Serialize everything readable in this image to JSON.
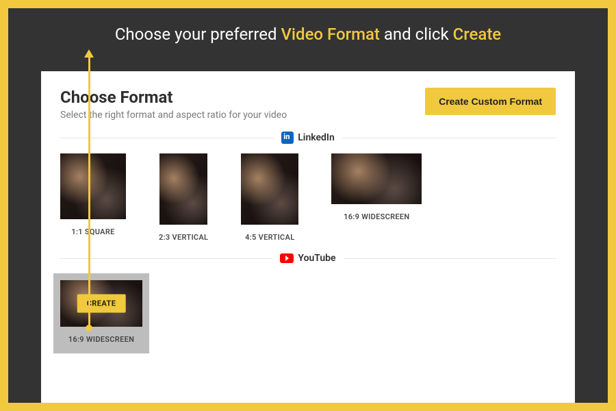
{
  "instruction": {
    "pre": "Choose  your preferred  ",
    "h1": "Video Format",
    "mid": " and click ",
    "h2": "Create"
  },
  "panel": {
    "title": "Choose Format",
    "subtitle": "Select the right format and aspect ratio for your video",
    "custom_button": "Create Custom Format"
  },
  "sections": {
    "linkedin": {
      "label": "LinkedIn",
      "formats": [
        {
          "label": "1:1 SQUARE"
        },
        {
          "label": "2:3 VERTICAL"
        },
        {
          "label": "4:5 VERTICAL"
        },
        {
          "label": "16:9 WIDESCREEN"
        }
      ]
    },
    "youtube": {
      "label": "YouTube",
      "formats": [
        {
          "label": "16:9 WIDESCREEN",
          "create_label": "CREATE"
        }
      ]
    }
  },
  "colors": {
    "accent": "#f0c93f",
    "dark": "#333333"
  }
}
